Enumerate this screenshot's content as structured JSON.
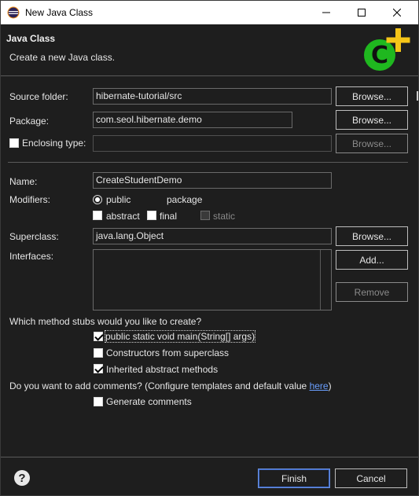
{
  "window": {
    "title": "New Java Class",
    "minimize": "—",
    "maximize": "☐",
    "close": "✕"
  },
  "banner": {
    "heading": "Java Class",
    "description": "Create a new Java class."
  },
  "source_folder": {
    "label": "Source folder:",
    "value": "hibernate-tutorial/src",
    "browse_label": "Browse..."
  },
  "package": {
    "label": "Package:",
    "value": "com.seol.hibernate.demo",
    "browse_label": "Browse..."
  },
  "enclosing_type": {
    "label": "Enclosing type:",
    "checked": false,
    "value": "",
    "browse_label": "Browse..."
  },
  "name": {
    "label": "Name:",
    "value": "CreateStudentDemo"
  },
  "modifiers": {
    "label": "Modifiers:",
    "access": [
      {
        "label": "public",
        "selected": true
      },
      {
        "label": "package",
        "selected": false
      }
    ],
    "flags": [
      {
        "label": "abstract",
        "checked": false,
        "enabled": true
      },
      {
        "label": "final",
        "checked": false,
        "enabled": true
      },
      {
        "label": "static",
        "checked": false,
        "enabled": false
      }
    ]
  },
  "superclass": {
    "label": "Superclass:",
    "value": "java.lang.Object",
    "browse_label": "Browse..."
  },
  "interfaces": {
    "label": "Interfaces:",
    "add_label": "Add...",
    "remove_label": "Remove"
  },
  "stubs": {
    "question": "Which method stubs would you like to create?",
    "options": [
      {
        "label": "public static void main(String[] args)",
        "checked": true
      },
      {
        "label": "Constructors from superclass",
        "checked": false
      },
      {
        "label": "Inherited abstract methods",
        "checked": true
      }
    ]
  },
  "comments": {
    "question": "Do you want to add comments? (Configure templates and default value ",
    "link": "here",
    "question_end": ")",
    "generate_label": "Generate comments",
    "generate_checked": false
  },
  "footer": {
    "help": "?",
    "finish_label": "Finish",
    "cancel_label": "Cancel"
  },
  "colors": {
    "background": "#1e1e1e",
    "icon_green": "#1fb81f",
    "icon_plus": "#f5c518",
    "link": "#6a9fff"
  }
}
